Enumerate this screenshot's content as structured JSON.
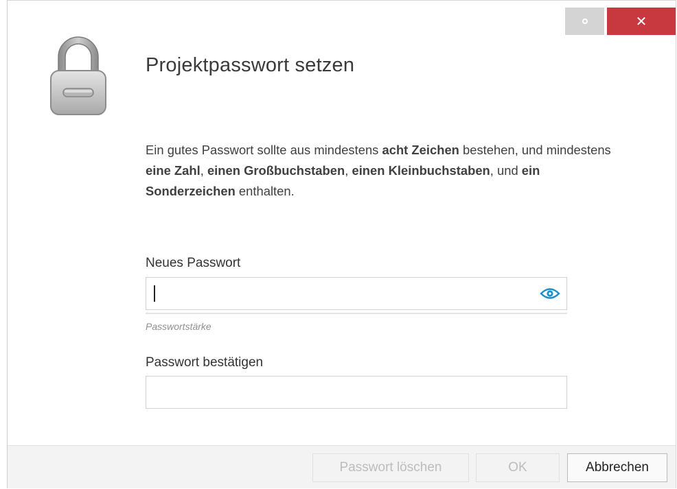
{
  "dialog": {
    "title": "Projektpasswort setzen",
    "description": {
      "p1": "Ein gutes Passwort sollte aus mindestens ",
      "b1": "acht Zeichen",
      "p2": " bestehen, und mindestens ",
      "b2": "eine Zahl",
      "p3": ", ",
      "b3": "einen Großbuchstaben",
      "p4": ", ",
      "b4": "einen Kleinbuchstaben",
      "p5": ", und ",
      "b5": "ein Sonderzeichen",
      "p6": " enthalten."
    },
    "new_password": {
      "label": "Neues Passwort",
      "value": "",
      "strength_label": "Passwortstärke"
    },
    "confirm_password": {
      "label": "Passwort bestätigen",
      "value": ""
    },
    "buttons": {
      "delete": "Passwort löschen",
      "ok": "OK",
      "cancel": "Abbrechen"
    },
    "window": {
      "close_glyph": "✕"
    }
  },
  "icons": {
    "lock": "lock-icon",
    "eye": "eye-icon",
    "restore": "restore-icon",
    "close": "close-icon"
  },
  "colors": {
    "close_button": "#c8393f",
    "eye_icon": "#1a8fc9",
    "disabled_text": "#bcbcbc"
  }
}
